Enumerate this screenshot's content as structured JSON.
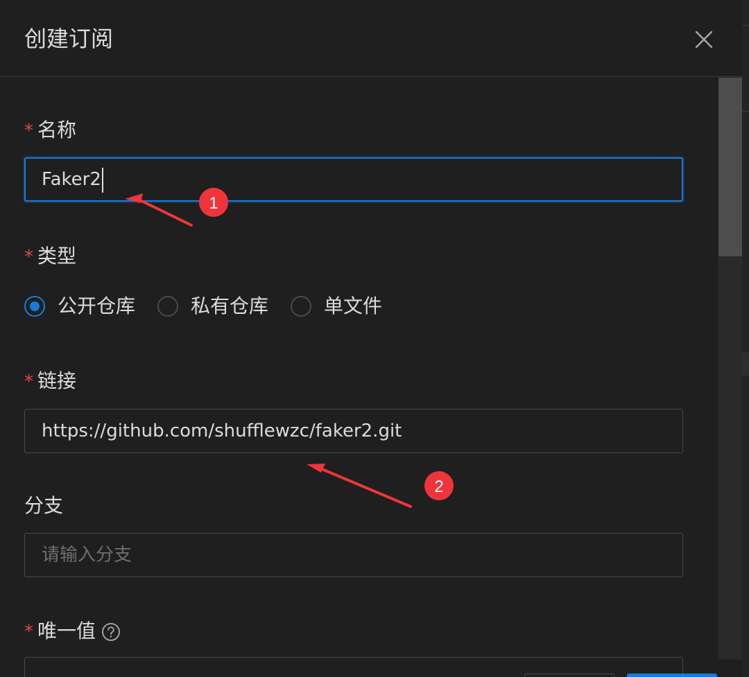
{
  "dialog": {
    "title": "创建订阅"
  },
  "form": {
    "name": {
      "required_mark": "*",
      "label": "名称",
      "value": "Faker2"
    },
    "type": {
      "required_mark": "*",
      "label": "类型",
      "options": [
        "公开仓库",
        "私有仓库",
        "单文件"
      ],
      "selected": "公开仓库"
    },
    "url": {
      "required_mark": "*",
      "label": "链接",
      "value": "https://github.com/shufflewzc/faker2.git"
    },
    "branch": {
      "label": "分支",
      "placeholder": "请输入分支"
    },
    "unique": {
      "required_mark": "*",
      "label": "唯一值"
    }
  },
  "annotations": {
    "marker_1": "1",
    "marker_2": "2",
    "color": "#f0353a"
  },
  "colors": {
    "accent": "#177ddc",
    "required": "#e84545",
    "background": "#1f1f1f"
  },
  "icons": {
    "close": "close-icon",
    "help": "question-circle-icon"
  }
}
